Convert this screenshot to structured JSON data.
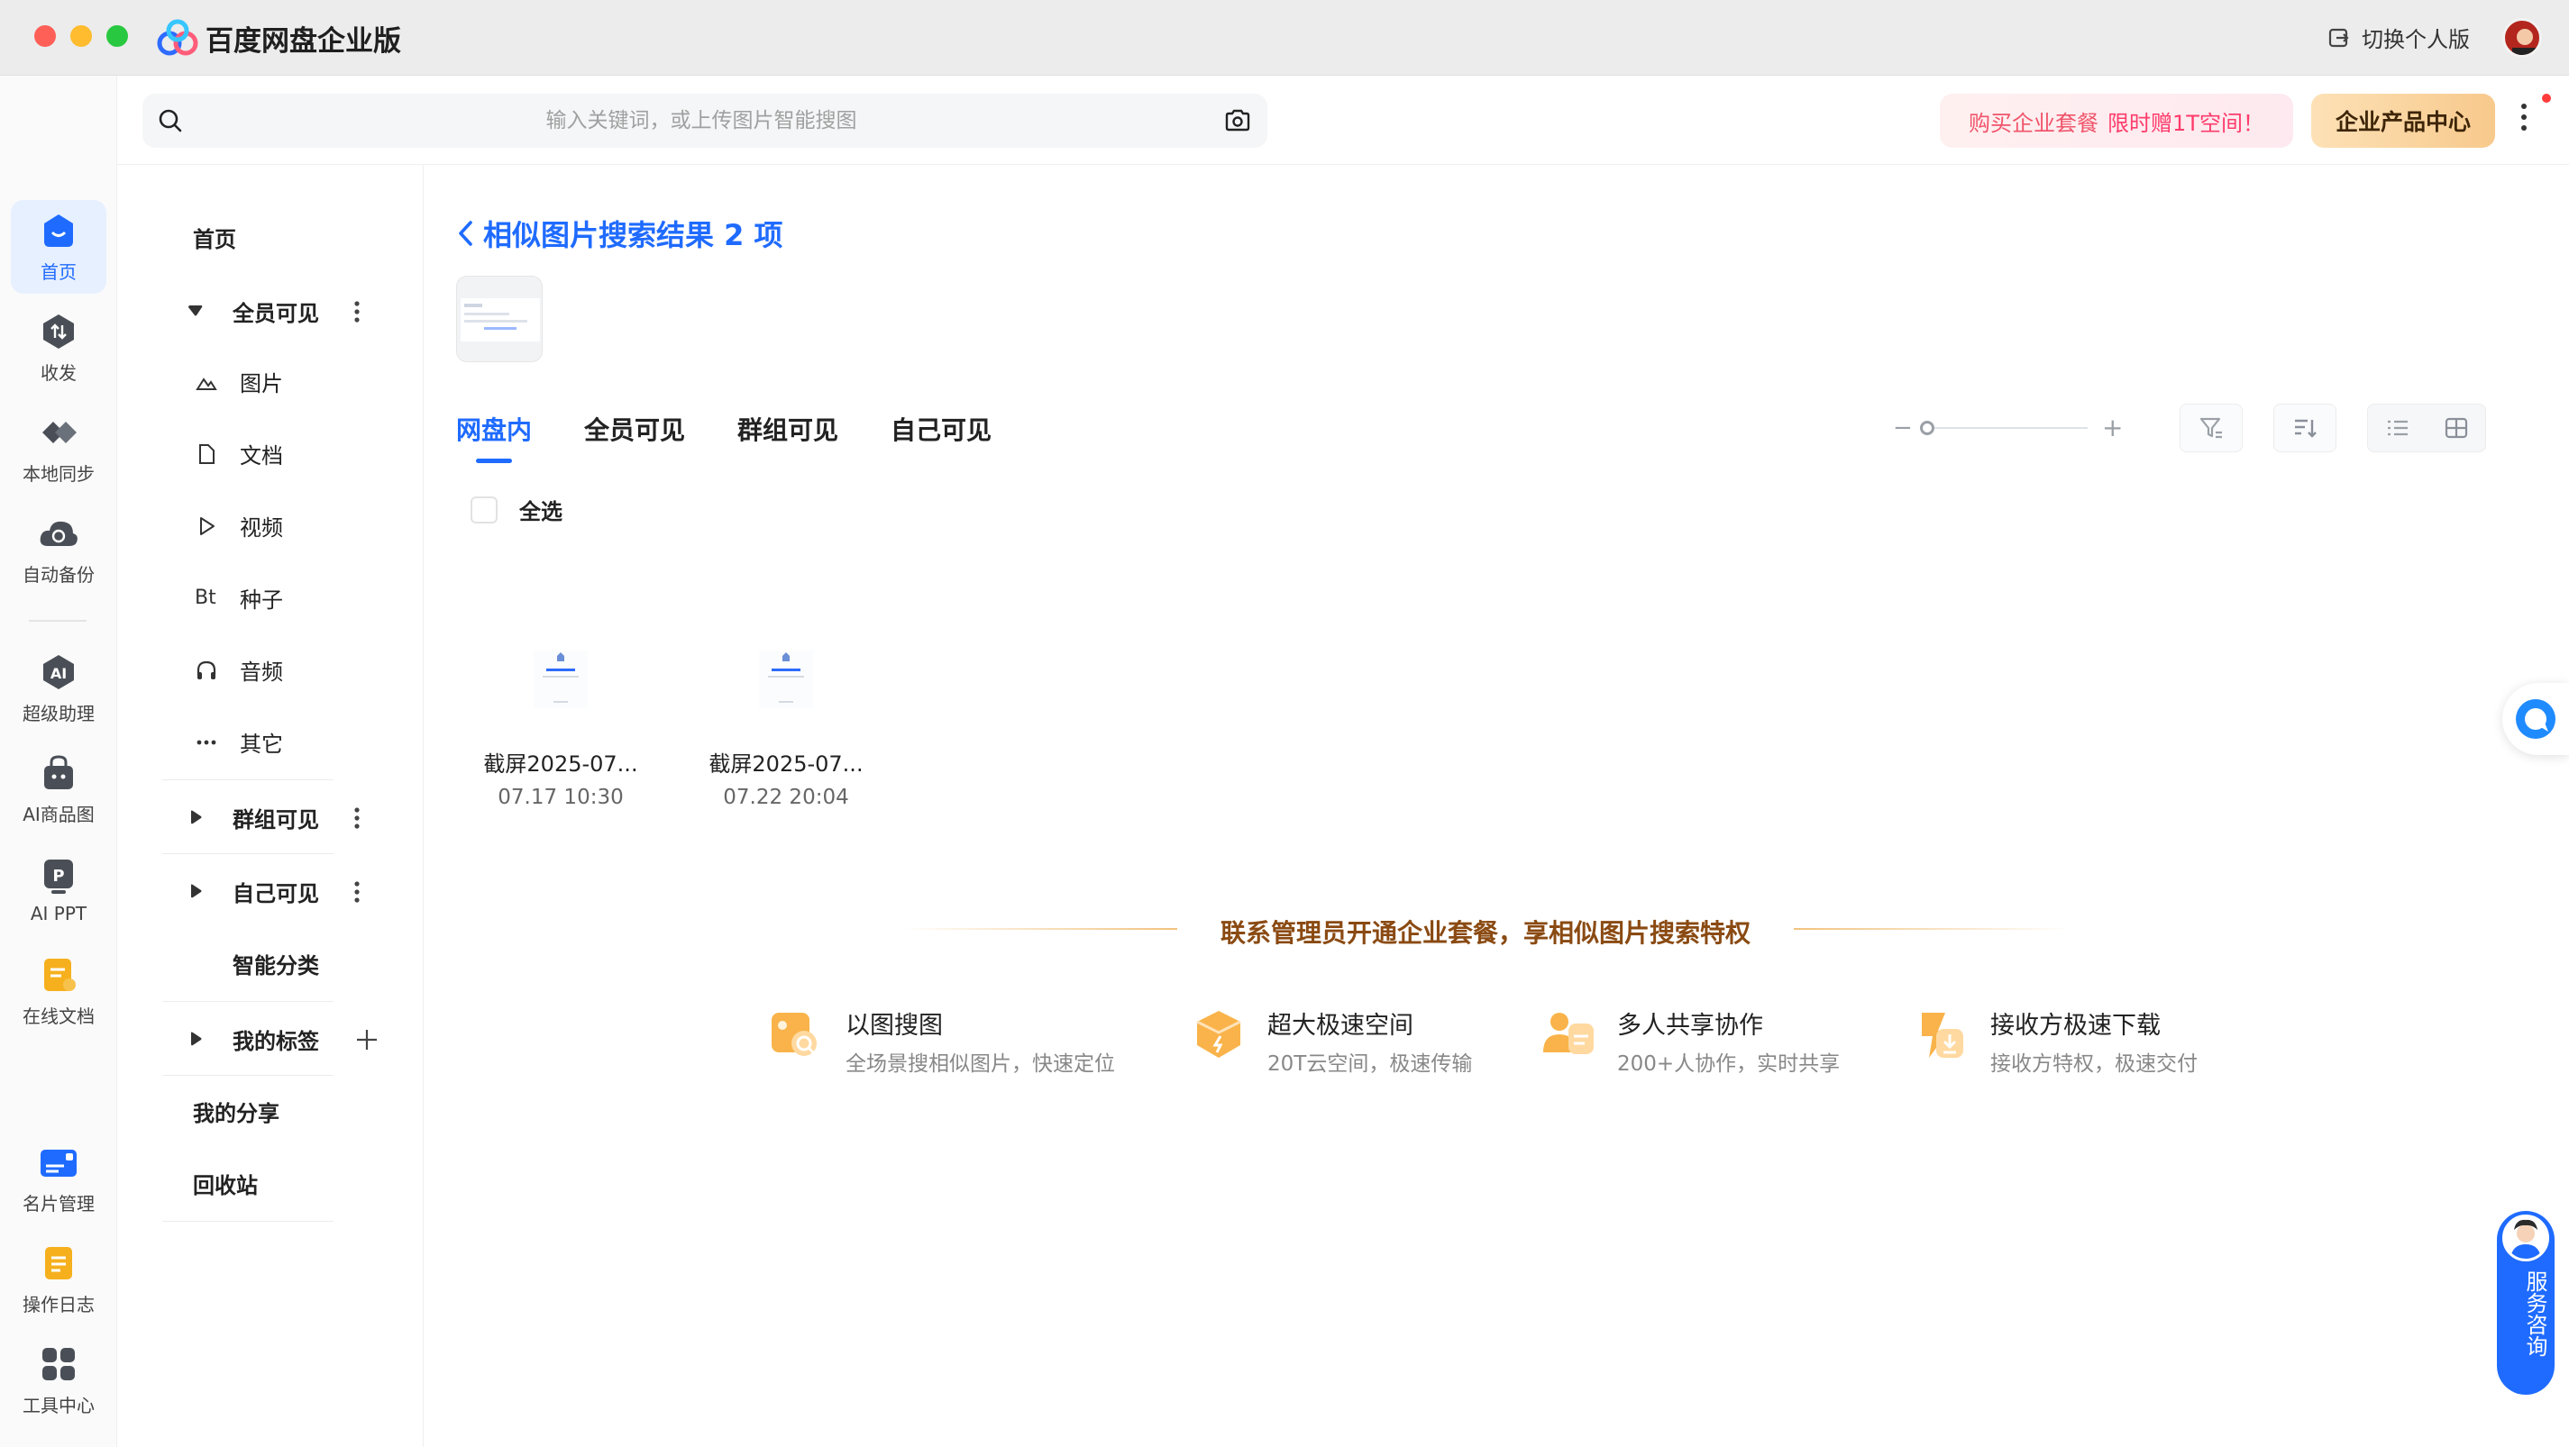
{
  "window": {
    "title": "百度网盘企业版",
    "switch_label": "切换个人版"
  },
  "rail": [
    {
      "label": "首页",
      "icon": "home-icon"
    },
    {
      "label": "收发",
      "icon": "transfer-icon"
    },
    {
      "label": "本地同步",
      "icon": "sync-icon"
    },
    {
      "label": "自动备份",
      "icon": "backup-icon"
    },
    {
      "label": "超级助理",
      "icon": "ai-assistant-icon"
    },
    {
      "label": "AI商品图",
      "icon": "ai-product-icon"
    },
    {
      "label": "AI PPT",
      "icon": "ai-ppt-icon"
    },
    {
      "label": "在线文档",
      "icon": "online-doc-icon"
    },
    {
      "label": "名片管理",
      "icon": "card-icon"
    },
    {
      "label": "操作日志",
      "icon": "log-icon"
    },
    {
      "label": "工具中心",
      "icon": "tools-icon"
    }
  ],
  "search": {
    "placeholder": "输入关键词，或上传图片智能搜图"
  },
  "promo": {
    "text": "购买企业套餐",
    "highlight": "限时赠1T空间！"
  },
  "product_center": "企业产品中心",
  "sidebar": {
    "home": "首页",
    "all_visible": "全员可见",
    "types": [
      {
        "label": "图片",
        "icon": "image-icon"
      },
      {
        "label": "文档",
        "icon": "document-icon"
      },
      {
        "label": "视频",
        "icon": "video-icon"
      },
      {
        "label": "种子",
        "icon": "torrent-icon",
        "glyph": "Bt"
      },
      {
        "label": "音频",
        "icon": "audio-icon"
      },
      {
        "label": "其它",
        "icon": "other-icon"
      }
    ],
    "group_visible": "群组可见",
    "self_visible": "自己可见",
    "smart_category": "智能分类",
    "my_tags": "我的标签",
    "my_share": "我的分享",
    "recycle": "回收站"
  },
  "main": {
    "heading": "相似图片搜索结果 2 项",
    "tabs": [
      "网盘内",
      "全员可见",
      "群组可见",
      "自己可见"
    ],
    "select_all": "全选",
    "files": [
      {
        "name": "截屏2025-07...",
        "date": "07.17 10:30"
      },
      {
        "name": "截屏2025-07...",
        "date": "07.22 20:04"
      }
    ],
    "upsell": "联系管理员开通企业套餐，享相似图片搜索特权",
    "features": [
      {
        "title": "以图搜图",
        "desc": "全场景搜相似图片，快速定位",
        "icon": "image-search-icon"
      },
      {
        "title": "超大极速空间",
        "desc": "20T云空间，极速传输",
        "icon": "storage-box-icon"
      },
      {
        "title": "多人共享协作",
        "desc": "200+人协作，实时共享",
        "icon": "collaboration-icon"
      },
      {
        "title": "接收方极速下载",
        "desc": "接收方特权，极速交付",
        "icon": "fast-download-icon"
      }
    ]
  },
  "service": {
    "label": "服务咨询"
  },
  "colors": {
    "accent": "#1f6bff",
    "promo": "#ff3b6b",
    "upsell": "#8a4a12"
  }
}
